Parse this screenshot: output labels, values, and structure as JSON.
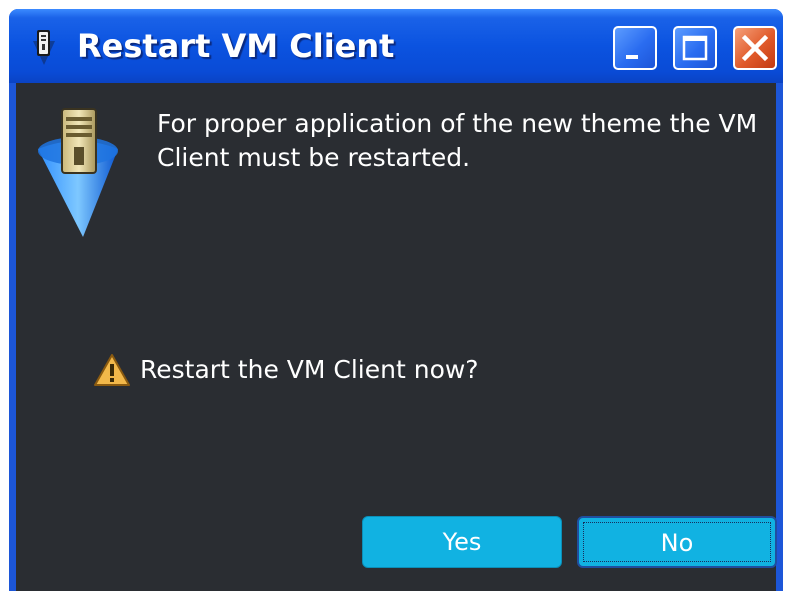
{
  "window": {
    "title": "Restart VM Client",
    "icon": "vm-client-app-icon",
    "controls": {
      "minimize": "minimize-icon",
      "maximize": "maximize-icon",
      "close": "close-icon"
    }
  },
  "dialog": {
    "icon": "server-icon",
    "message": "For proper application of the new theme the VM Client must be restarted.",
    "question_icon": "warning-icon",
    "question": "Restart the VM Client now?",
    "buttons": {
      "yes": "Yes",
      "no": "No"
    },
    "focused_button": "No"
  },
  "colors": {
    "titlebar": "#0a4bd6",
    "client_background": "#2a2d32",
    "button": "#11b2e2",
    "text": "#ffffff"
  }
}
